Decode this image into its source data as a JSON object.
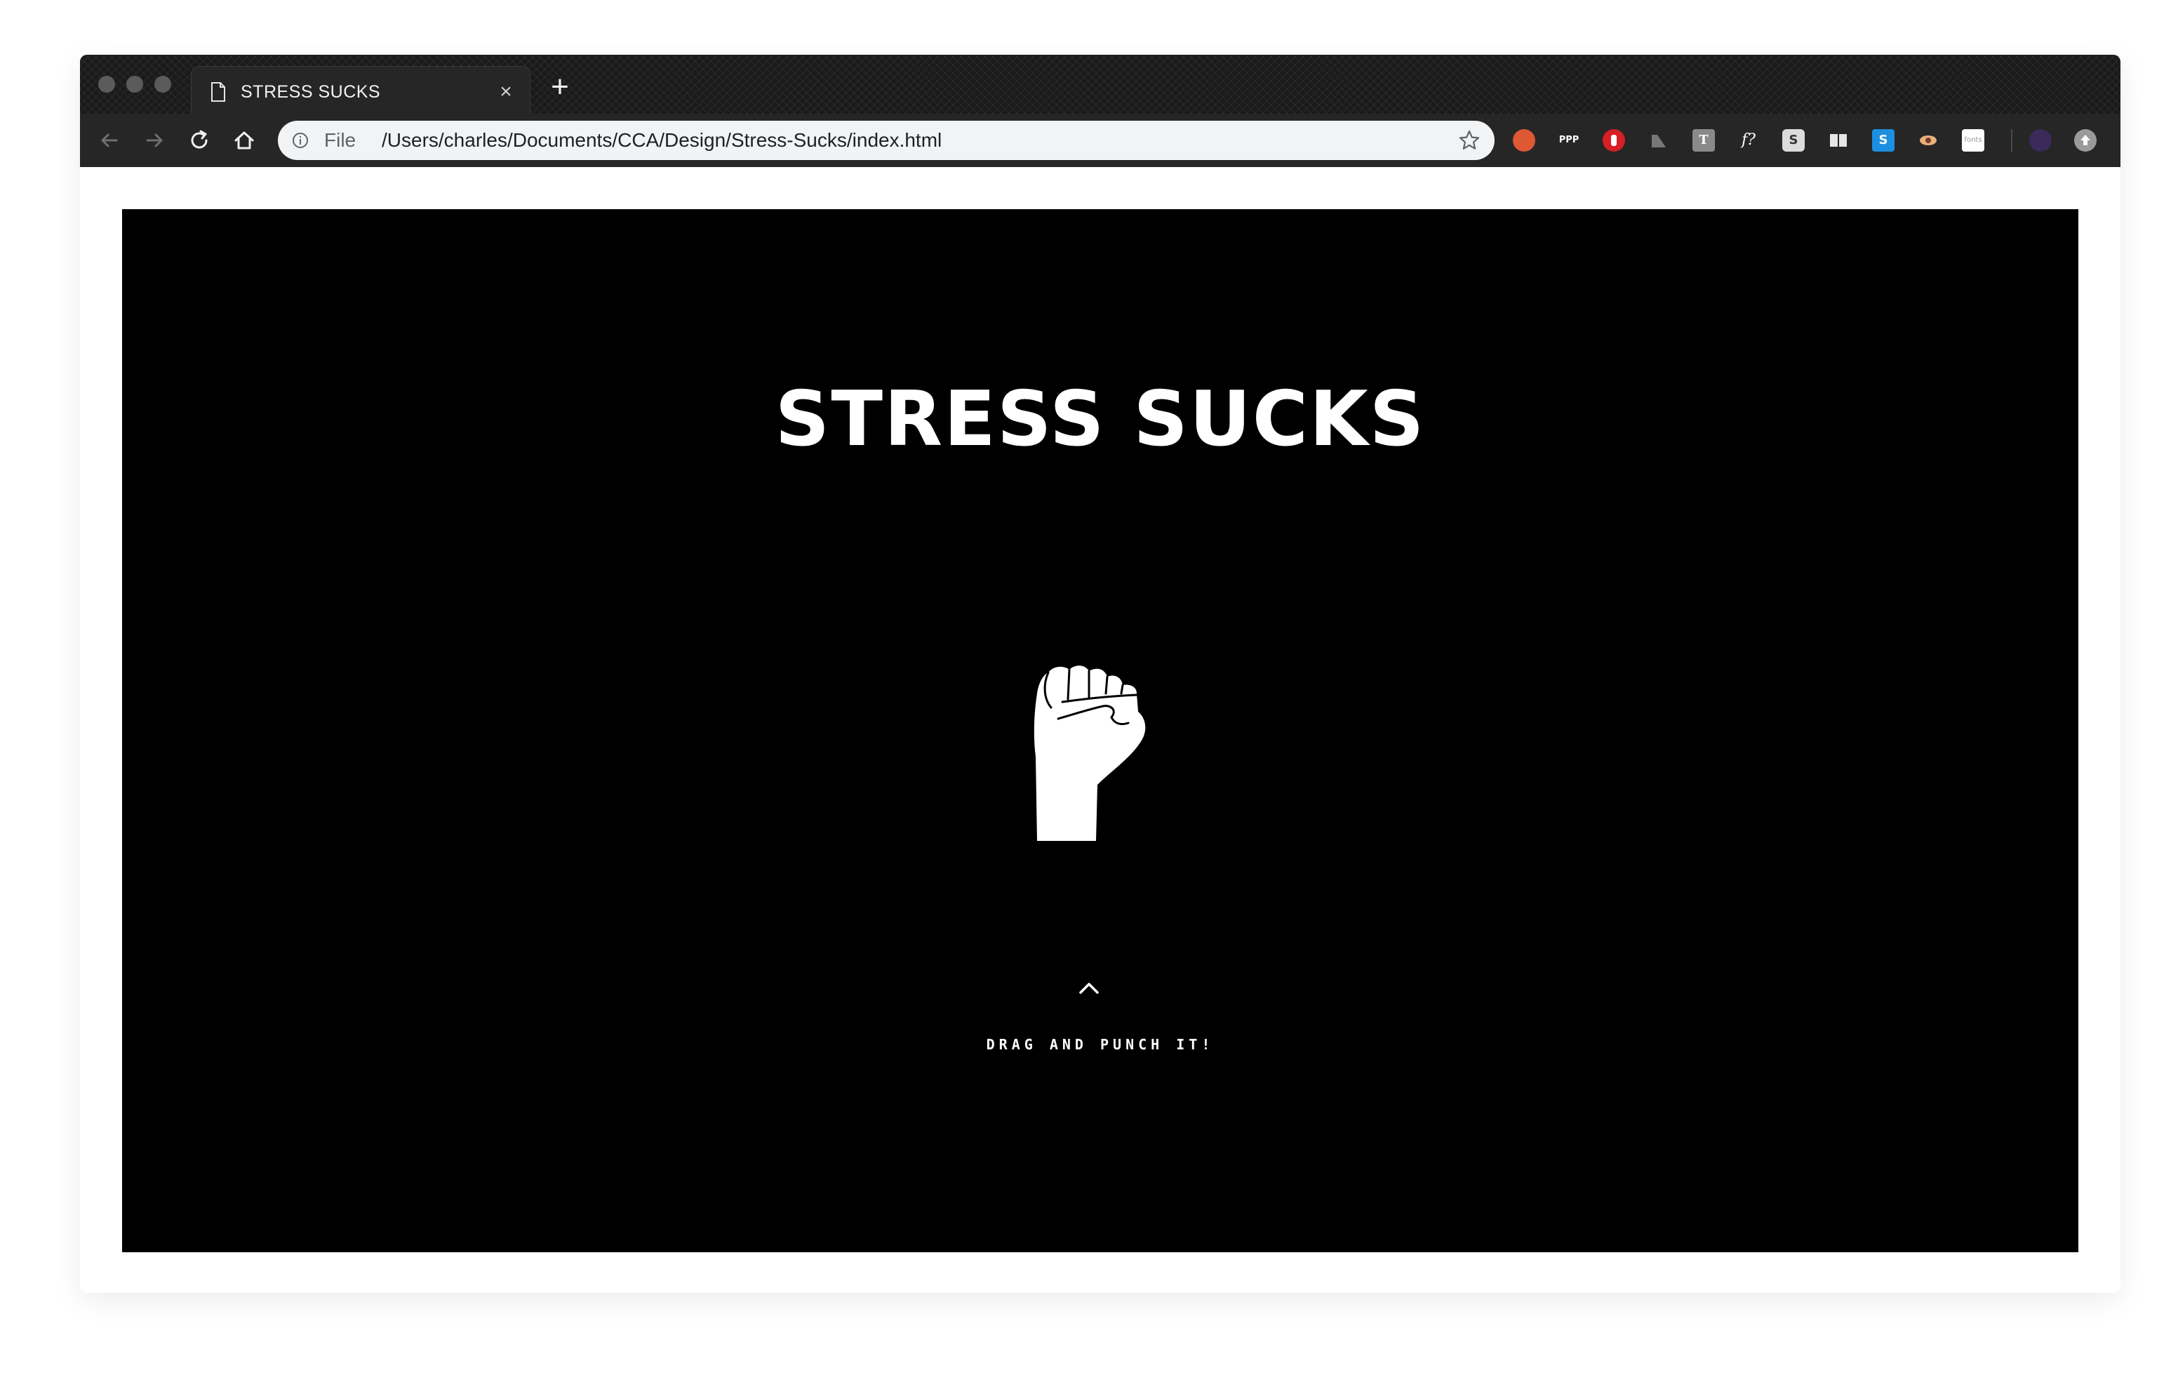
{
  "window": {
    "tab": {
      "title": "STRESS SUCKS",
      "close_glyph": "×"
    },
    "new_tab_glyph": "+"
  },
  "toolbar": {
    "omnibox": {
      "scheme_label": "File",
      "url": "/Users/charles/Documents/CCA/Design/Stress-Sucks/index.html"
    },
    "extensions": [
      {
        "name": "duckduckgo-icon",
        "glyph": ""
      },
      {
        "name": "ppp-extension-icon",
        "glyph": "PPP"
      },
      {
        "name": "adblock-hand-icon",
        "glyph": ""
      },
      {
        "name": "ruler-extension-icon",
        "glyph": ""
      },
      {
        "name": "text-extension-icon",
        "glyph": "T"
      },
      {
        "name": "whatfont-icon",
        "glyph": "f?"
      },
      {
        "name": "s-extension-icon",
        "glyph": "S"
      },
      {
        "name": "split-view-icon",
        "glyph": ""
      },
      {
        "name": "skype-icon",
        "glyph": "S"
      },
      {
        "name": "eye-extension-icon",
        "glyph": ""
      },
      {
        "name": "fonts-extension-icon",
        "glyph": "fonts"
      }
    ]
  },
  "page": {
    "title": "STRESS  SUCKS",
    "icon": "raised-fist-icon",
    "hint": "DRAG AND PUNCH IT!"
  },
  "colors": {
    "page_background": "#000000",
    "text": "#ffffff",
    "chrome_frame": "#1a1a1a",
    "toolbar": "#262626",
    "omnibox": "#f1f3f4"
  }
}
